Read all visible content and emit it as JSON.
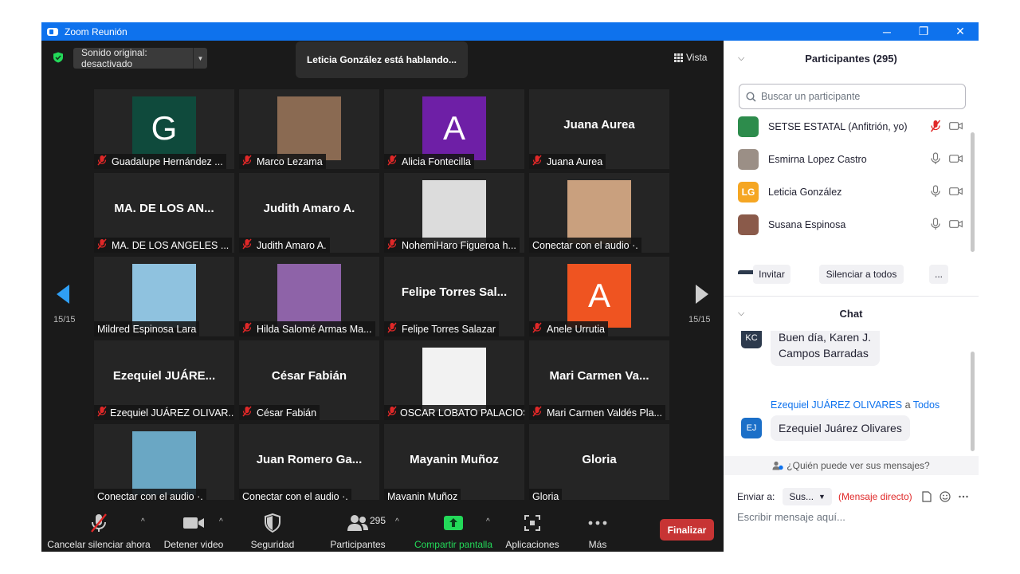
{
  "window": {
    "title": "Zoom Reunión",
    "controls": [
      "─",
      "❐",
      "✕"
    ]
  },
  "video": {
    "audio_pill": "Sonido original: desactivado",
    "speaking_banner": "Leticia González está hablando...",
    "view_label": "Vista",
    "page_left": "15/15",
    "page_right": "15/15",
    "tiles": [
      {
        "name": "Guadalupe Hernández ...",
        "muted": true,
        "avatar": "letter",
        "letter": "G",
        "color": "#0f4a3c"
      },
      {
        "name": "Marco Lezama",
        "muted": true,
        "avatar": "photo",
        "color": "#8a6a52"
      },
      {
        "name": "Alicia Fontecilla",
        "muted": true,
        "avatar": "letter",
        "letter": "A",
        "color": "#6e1fa6"
      },
      {
        "name": "Juana Aurea",
        "muted": true,
        "avatar": "text",
        "big": "Juana Aurea"
      },
      {
        "name": "MA. DE LOS ANGELES ...",
        "muted": true,
        "avatar": "text",
        "big": "MA. DE LOS AN..."
      },
      {
        "name": "Judith Amaro A.",
        "muted": true,
        "avatar": "text",
        "big": "Judith Amaro A."
      },
      {
        "name": "NohemiHaro Figueroa h...",
        "muted": true,
        "avatar": "photo",
        "color": "#dcdcdc"
      },
      {
        "name": "Conectar con el audio ·.",
        "muted": false,
        "avatar": "photo",
        "color": "#c9a07e"
      },
      {
        "name": "Mildred Espinosa Lara",
        "muted": false,
        "avatar": "photo",
        "color": "#8fc2df"
      },
      {
        "name": "Hilda Salomé Armas Ma...",
        "muted": true,
        "avatar": "photo",
        "color": "#8e63a8"
      },
      {
        "name": "Felipe Torres Salazar",
        "muted": true,
        "avatar": "text",
        "big": "Felipe Torres Sal..."
      },
      {
        "name": "Anele Urrutia",
        "muted": true,
        "avatar": "letter",
        "letter": "A",
        "color": "#ef5421"
      },
      {
        "name": "Ezequiel JUÁREZ OLIVAR...",
        "muted": true,
        "avatar": "text",
        "big": "Ezequiel JUÁRE..."
      },
      {
        "name": "César Fabián",
        "muted": true,
        "avatar": "text",
        "big": "César Fabián"
      },
      {
        "name": "OSCAR LOBATO PALACIOS",
        "muted": true,
        "avatar": "photo",
        "color": "#f2f2f2"
      },
      {
        "name": "Mari Carmen Valdés Pla...",
        "muted": true,
        "avatar": "text",
        "big": "Mari Carmen Va..."
      },
      {
        "name": "Conectar con el audio ·.",
        "muted": false,
        "avatar": "photo",
        "color": "#6aa7c4"
      },
      {
        "name": "Conectar con el audio ·.",
        "muted": false,
        "avatar": "text",
        "big": "Juan Romero Ga..."
      },
      {
        "name": "Mayanin Muñoz",
        "muted": false,
        "avatar": "text",
        "big": "Mayanin Muñoz"
      },
      {
        "name": "Gloria",
        "muted": false,
        "avatar": "text",
        "big": "Gloria"
      }
    ]
  },
  "toolbar": {
    "unmute": "Cancelar silenciar ahora",
    "stop_video": "Detener video",
    "security": "Seguridad",
    "participants": "Participantes",
    "participants_count": "295",
    "share": "Compartir pantalla",
    "apps": "Aplicaciones",
    "more": "Más",
    "end": "Finalizar",
    "caret": "^",
    "share_color": "#23d959",
    "end_color": "#c73434"
  },
  "participants_panel": {
    "title": "Participantes (295)",
    "search_placeholder": "Buscar un participante",
    "list": [
      {
        "name": "SETSE ESTATAL (Anfitrión, yo)",
        "muted": true,
        "avatar": "photo",
        "color": "#2d8c4c"
      },
      {
        "name": "Esmirna Lopez Castro",
        "muted": false,
        "avatar": "photo",
        "color": "#9b8f86"
      },
      {
        "name": "Leticia González",
        "muted": false,
        "avatar": "initials",
        "initials": "LG",
        "color": "#f5a623"
      },
      {
        "name": "Susana Espinosa",
        "muted": false,
        "avatar": "photo",
        "color": "#8a5a4a"
      }
    ],
    "invite": "Invitar",
    "mute_all": "Silenciar a todos",
    "more": "..."
  },
  "chat": {
    "title": "Chat",
    "prev_avatar": "KC",
    "prev_msg_line1": "Buen día, Karen J.",
    "prev_msg_line2": "Campos Barradas",
    "sender": "Ezequiel JUÁREZ OLIVARES",
    "to_word": "a",
    "to_target": "Todos",
    "sender_avatar": "EJ",
    "message": "Ezequiel Juárez Olivares",
    "who_can_see": "¿Quién puede ver sus mensajes?",
    "send_to_label": "Enviar a:",
    "send_to_value": "Sus...",
    "direct_msg": "(Mensaje directo)",
    "compose_placeholder": "Escribir mensaje aquí..."
  }
}
